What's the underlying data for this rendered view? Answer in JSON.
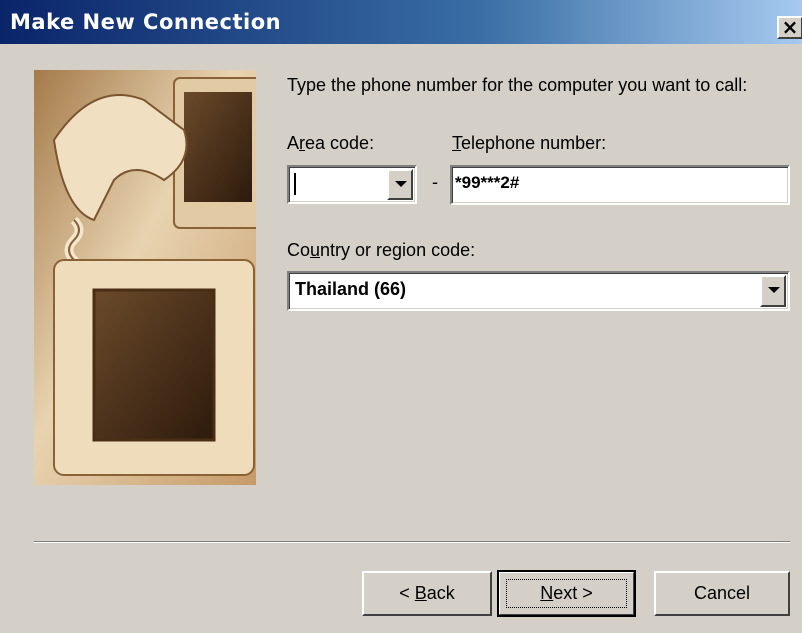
{
  "window": {
    "title": "Make New Connection",
    "close_label": "×"
  },
  "instructions": "Type the phone number for the computer you want to call:",
  "area_code": {
    "label_prefix": "A",
    "label_mnemonic": "r",
    "label_suffix": "ea code:",
    "value": ""
  },
  "separator_dash": "-",
  "telephone": {
    "label_mnemonic": "T",
    "label_suffix": "elephone number:",
    "value": "*99***2#"
  },
  "country": {
    "label_prefix": "Co",
    "label_mnemonic": "u",
    "label_suffix": "ntry or region code:",
    "value": "Thailand (66)"
  },
  "buttons": {
    "back": {
      "prefix": "< ",
      "mnemonic": "B",
      "suffix": "ack"
    },
    "next": {
      "mnemonic": "N",
      "suffix": "ext >"
    },
    "cancel": "Cancel"
  }
}
